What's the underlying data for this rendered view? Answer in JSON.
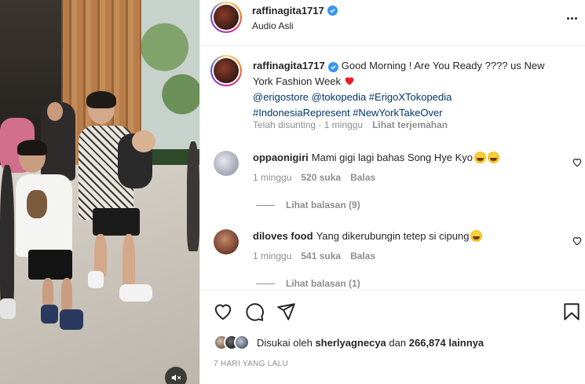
{
  "header": {
    "username": "raffinagita1717",
    "subtitle": "Audio Asli"
  },
  "caption": {
    "username": "raffinagita1717",
    "text": "Good Morning ! Are You Ready ???? us New York Fashion Week",
    "tags_line1": "@erigostore @tokopedia #ErigoXTokopedia",
    "tags_line2": "#IndonesiaRepresent #NewYorkTakeOver",
    "edited": "Telah disunting · 1 minggu",
    "translate": "Lihat terjemahan"
  },
  "comments": [
    {
      "username": "oppaonigiri",
      "text": "Mami gigi lagi bahas Song Hye Kyo",
      "time": "1 minggu",
      "likes": "520 suka",
      "reply": "Balas",
      "view_replies": "Lihat balasan (9)"
    },
    {
      "username": "diloves food",
      "text": "Yang dikerubungin tetep si cipung",
      "time": "1 minggu",
      "likes": "541 suka",
      "reply": "Balas",
      "view_replies": "Lihat balasan (1)"
    }
  ],
  "likes": {
    "prefix": "Disukai oleh",
    "user": "sherlyagnecya",
    "middle": "dan",
    "count": "266,874 lainnya"
  },
  "timestamp": "7 HARI YANG LALU",
  "icons": {
    "verified": "verified-badge-icon",
    "more": "more-options-icon",
    "heart": "heart-icon",
    "comment": "comment-icon",
    "share": "share-icon",
    "bookmark": "bookmark-icon",
    "mute": "mute-icon"
  },
  "colors": {
    "link": "#00376b",
    "verified": "#3897f0",
    "muted_text": "#8e8e8e",
    "heart_red": "#ed1c24"
  }
}
